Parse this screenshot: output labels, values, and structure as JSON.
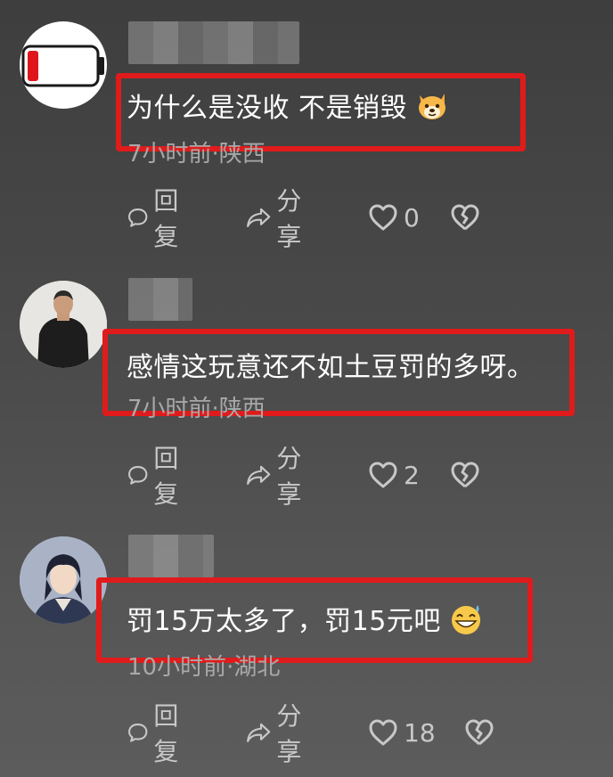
{
  "comments": [
    {
      "text": "为什么是没收  不是销毁",
      "emoji": "dog-face-emoji",
      "meta": "7小时前·陕西",
      "reply_label": "回复",
      "share_label": "分享",
      "likes": "0"
    },
    {
      "text": "感情这玩意还不如土豆罚的多呀。",
      "meta": "7小时前·陕西",
      "reply_label": "回复",
      "share_label": "分享",
      "likes": "2"
    },
    {
      "text": "罚15万太多了，罚15元吧",
      "emoji": "grinning-sweat-emoji",
      "meta": "10小时前·湖北",
      "reply_label": "回复",
      "share_label": "分享",
      "likes": "18"
    }
  ],
  "colors": {
    "highlight": "#e01b1b",
    "battery_red": "#e0151c"
  }
}
